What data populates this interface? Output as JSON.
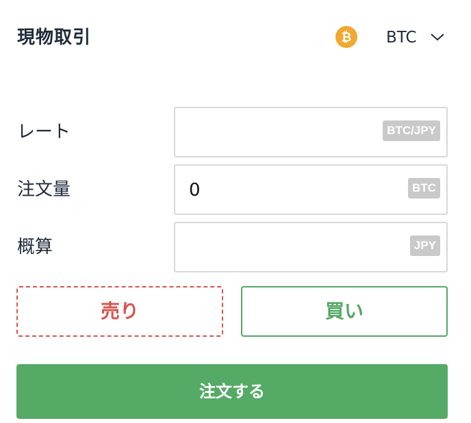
{
  "header": {
    "title": "現物取引",
    "coin": {
      "symbol": "BTC",
      "icon": "bitcoin-icon",
      "icon_color": "#f0a830",
      "dropdown_icon": "chevron-down-icon"
    }
  },
  "form": {
    "rate": {
      "label": "レート",
      "value": "",
      "unit": "BTC/JPY"
    },
    "quantity": {
      "label": "注文量",
      "value": "0",
      "unit": "BTC"
    },
    "estimate": {
      "label": "概算",
      "value": "",
      "unit": "JPY"
    }
  },
  "actions": {
    "sell_label": "売り",
    "buy_label": "買い",
    "order_label": "注文する",
    "selected_side": "buy"
  },
  "colors": {
    "sell": "#d9534f",
    "buy": "#53a864",
    "order_button": "#55aa66",
    "unit_badge": "#c9c9c9",
    "text": "#1e2a3a"
  }
}
